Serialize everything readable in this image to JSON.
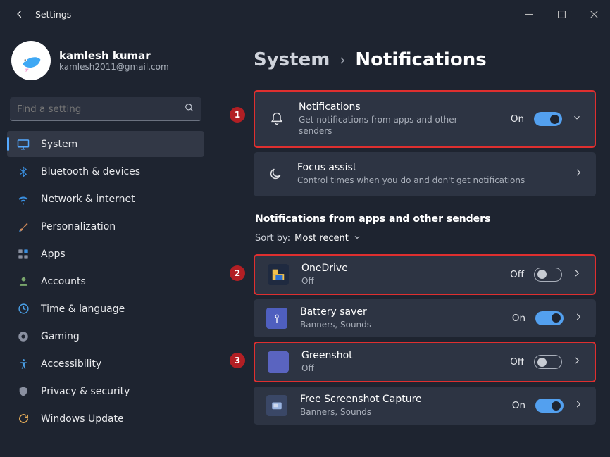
{
  "window": {
    "title": "Settings"
  },
  "user": {
    "name": "kamlesh kumar",
    "email": "kamlesh2011@gmail.com"
  },
  "search": {
    "placeholder": "Find a setting"
  },
  "nav": [
    {
      "label": "System",
      "active": true
    },
    {
      "label": "Bluetooth & devices"
    },
    {
      "label": "Network & internet"
    },
    {
      "label": "Personalization"
    },
    {
      "label": "Apps"
    },
    {
      "label": "Accounts"
    },
    {
      "label": "Time & language"
    },
    {
      "label": "Gaming"
    },
    {
      "label": "Accessibility"
    },
    {
      "label": "Privacy & security"
    },
    {
      "label": "Windows Update"
    }
  ],
  "breadcrumb": {
    "parent": "System",
    "current": "Notifications"
  },
  "cards": {
    "notifications": {
      "title": "Notifications",
      "sub": "Get notifications from apps and other senders",
      "state_label": "On"
    },
    "focus": {
      "title": "Focus assist",
      "sub": "Control times when you do and don't get notifications"
    }
  },
  "section": {
    "title": "Notifications from apps and other senders",
    "sort_label": "Sort by:",
    "sort_value": "Most recent"
  },
  "apps": [
    {
      "title": "OneDrive",
      "sub": "Off",
      "state_label": "Off",
      "on": false
    },
    {
      "title": "Battery saver",
      "sub": "Banners, Sounds",
      "state_label": "On",
      "on": true
    },
    {
      "title": "Greenshot",
      "sub": "Off",
      "state_label": "Off",
      "on": false
    },
    {
      "title": "Free Screenshot Capture",
      "sub": "Banners, Sounds",
      "state_label": "On",
      "on": true
    }
  ],
  "labels": {
    "on": "On",
    "off": "Off"
  },
  "annotations": {
    "n1": "1",
    "n2": "2",
    "n3": "3"
  }
}
